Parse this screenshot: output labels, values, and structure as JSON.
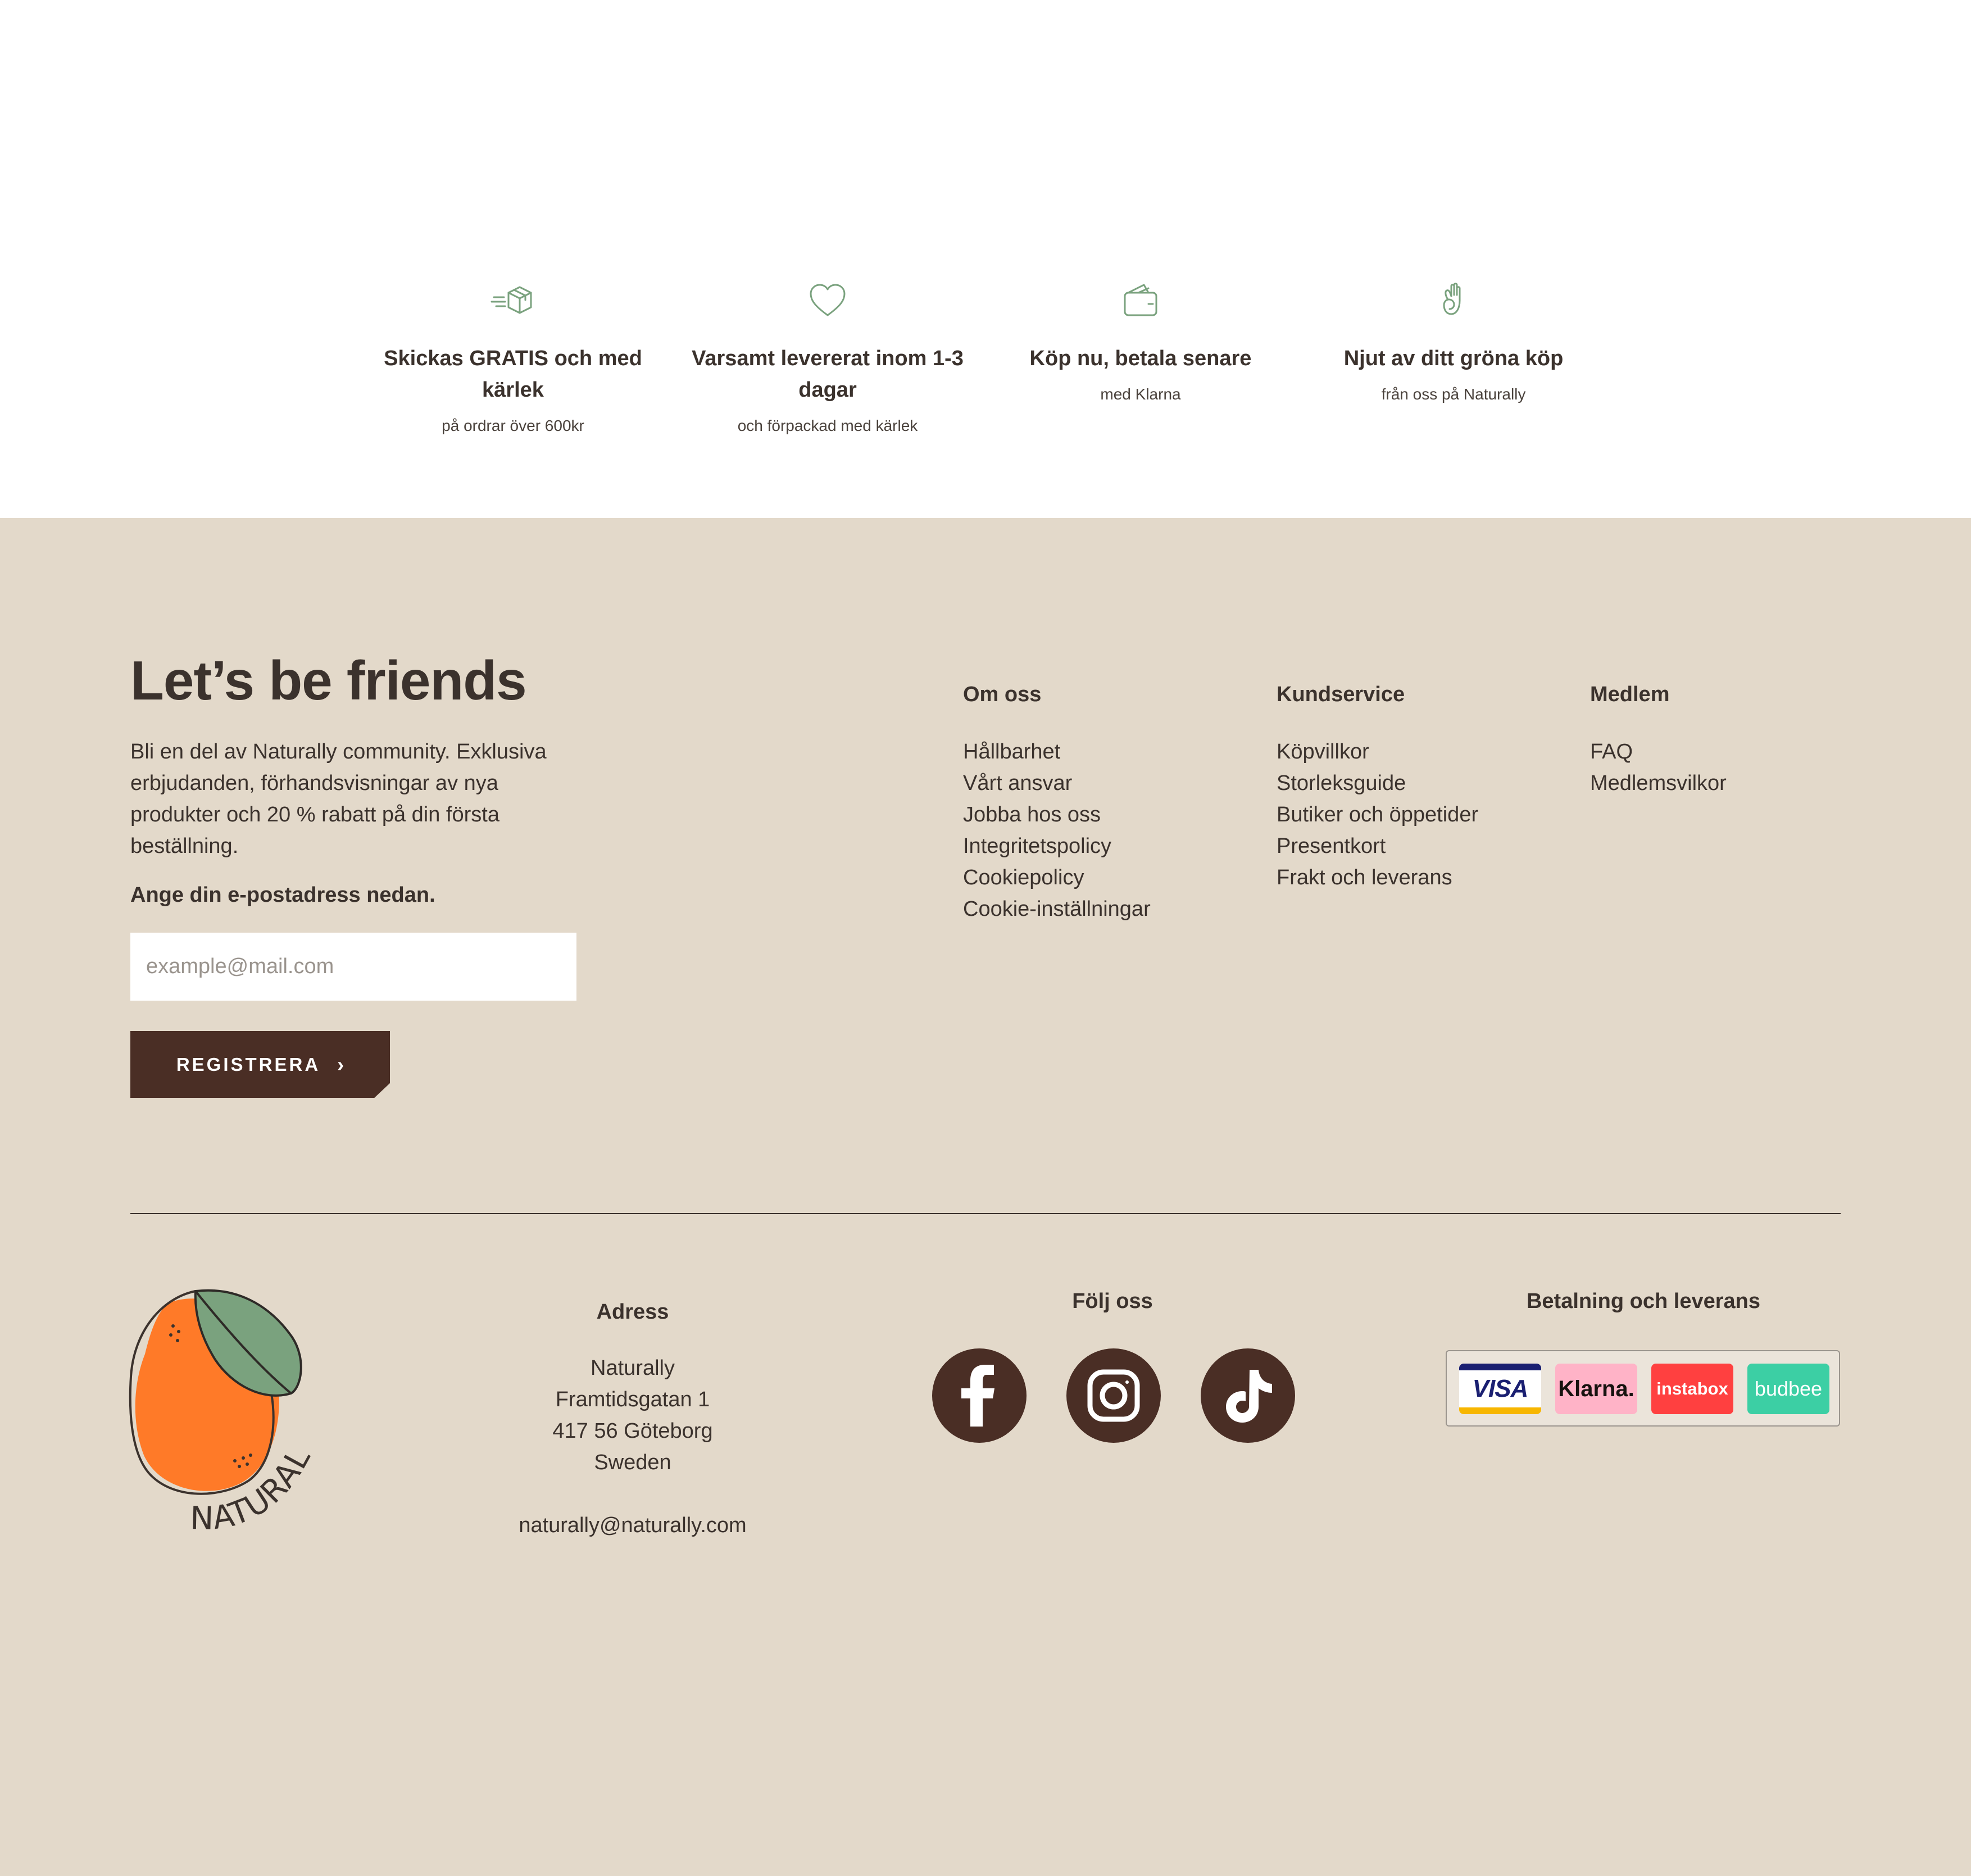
{
  "features": [
    {
      "icon": "delivery-box-icon",
      "title": "Skickas GRATIS och med kärlek",
      "subtitle": "på ordrar över 600kr"
    },
    {
      "icon": "heart-icon",
      "title": "Varsamt levererat inom 1-3 dagar",
      "subtitle": "och förpackad med kärlek"
    },
    {
      "icon": "wallet-icon",
      "title": "Köp nu, betala senare",
      "subtitle": "med Klarna"
    },
    {
      "icon": "ok-hand-icon",
      "title": "Njut av ditt gröna köp",
      "subtitle": "från oss på Naturally"
    }
  ],
  "newsletter": {
    "headline": "Let’s be friends",
    "intro": "Bli en del av Naturally community. Exklusiva erbjudanden, förhandsvisningar av nya produkter och 20 % rabatt på din första beställning.",
    "prompt": "Ange din e-postadress nedan.",
    "email_placeholder": "example@mail.com",
    "email_value": "",
    "button_label": "REGISTRERA",
    "button_chevron": "›"
  },
  "link_columns": [
    {
      "title": "Om oss",
      "links": [
        "Hållbarhet",
        "Vårt ansvar",
        "Jobba hos oss",
        "Integritetspolicy",
        "Cookiepolicy",
        "Cookie-inställningar"
      ]
    },
    {
      "title": "Kundservice",
      "links": [
        "Köpvillkor",
        "Storleksguide",
        "Butiker och öppetider",
        "Presentkort",
        "Frakt och leverans"
      ]
    },
    {
      "title": "Medlem",
      "links": [
        "FAQ",
        "Medlemsvilkor"
      ]
    }
  ],
  "logo": {
    "text": "NATURALLY"
  },
  "address": {
    "title": "Adress",
    "lines": [
      "Naturally",
      "Framtidsgatan 1",
      "417 56 Göteborg",
      "Sweden"
    ],
    "email": "naturally@naturally.com"
  },
  "social": {
    "title": "Följ oss",
    "icons": [
      "facebook-icon",
      "instagram-icon",
      "tiktok-icon"
    ]
  },
  "payment": {
    "title": "Betalning och leverans",
    "methods": [
      "VISA",
      "Klarna.",
      "instabox",
      "budbee"
    ]
  },
  "colors": {
    "accent_green": "#7aa27e",
    "footer_bg": "#e3d9ca",
    "dark_brown": "#4a2e25",
    "text": "#3b322d",
    "orange": "#ff7a28"
  }
}
